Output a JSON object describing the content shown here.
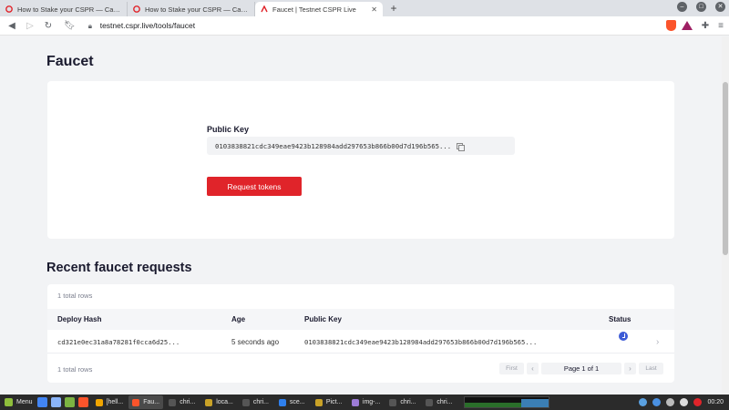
{
  "browser": {
    "tabs": [
      {
        "title": "How to Stake your CSPR — CasperLabs",
        "favicon_color": "#e0242a",
        "active": false
      },
      {
        "title": "How to Stake your CSPR — CasperLabs",
        "favicon_color": "#e0242a",
        "active": false
      },
      {
        "title": "Faucet | Testnet CSPR Live",
        "favicon_color": "#e0242a",
        "active": true
      }
    ],
    "new_tab": "+",
    "url": "testnet.cspr.live/tools/faucet"
  },
  "page": {
    "title": "Faucet",
    "public_key_label": "Public Key",
    "public_key_value": "0103838821cdc349eae9423b128984add297653b866b00d7d196b565...",
    "request_button": "Request tokens",
    "accent_color": "#e0242a"
  },
  "requests": {
    "title": "Recent faucet requests",
    "total_rows_top": "1 total rows",
    "total_rows_bottom": "1 total rows",
    "columns": {
      "deploy_hash": "Deploy Hash",
      "age": "Age",
      "public_key": "Public Key",
      "status": "Status"
    },
    "rows": [
      {
        "deploy_hash": "cd321e0ec31a8a78281f0cca6d25...",
        "age": "5 seconds ago",
        "public_key": "0103838821cdc349eae9423b128984add297653b866b00d7d196b565...",
        "status": "pending-clock-icon"
      }
    ],
    "pager": {
      "first": "First",
      "prev": "‹",
      "info": "Page 1 of 1",
      "next": "›",
      "last": "Last"
    }
  },
  "taskbar": {
    "menu": "Menu",
    "tasks": [
      "[hell...",
      "Fau...",
      "chri...",
      "loca...",
      "chri...",
      "sce...",
      "Pict...",
      "img-...",
      "chri...",
      "chri..."
    ],
    "clock": "00:20"
  }
}
